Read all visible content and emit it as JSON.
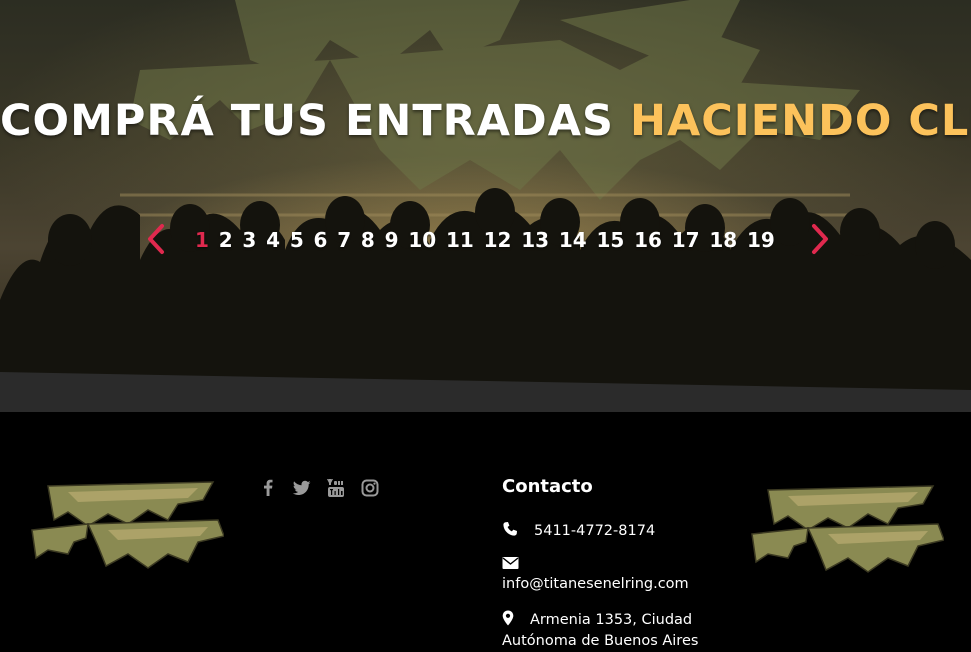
{
  "hero": {
    "title_white": "COMPRÁ TUS ENTRADAS ",
    "title_yellow": "HACIENDO CLICK",
    "colors": {
      "title_accent": "#fcc25b",
      "active_page": "#e0294e",
      "arrows": "#e0294e"
    }
  },
  "pagination": {
    "prev_icon": "chevron-left-icon",
    "next_icon": "chevron-right-icon",
    "active_page": "1",
    "pages": [
      "1",
      "2",
      "3",
      "4",
      "5",
      "6",
      "7",
      "8",
      "9",
      "10",
      "11",
      "12",
      "13",
      "14",
      "15",
      "16",
      "17",
      "18",
      "19"
    ]
  },
  "footer": {
    "social_icons": [
      "facebook-icon",
      "twitter-icon",
      "youtube-icon",
      "instagram-icon"
    ],
    "contact": {
      "title": "Contacto",
      "phone": "5411-4772-8174",
      "email": "info@titanesenelring.com",
      "address": "Armenia 1353, Ciudad Autónoma de Buenos Aires"
    }
  }
}
